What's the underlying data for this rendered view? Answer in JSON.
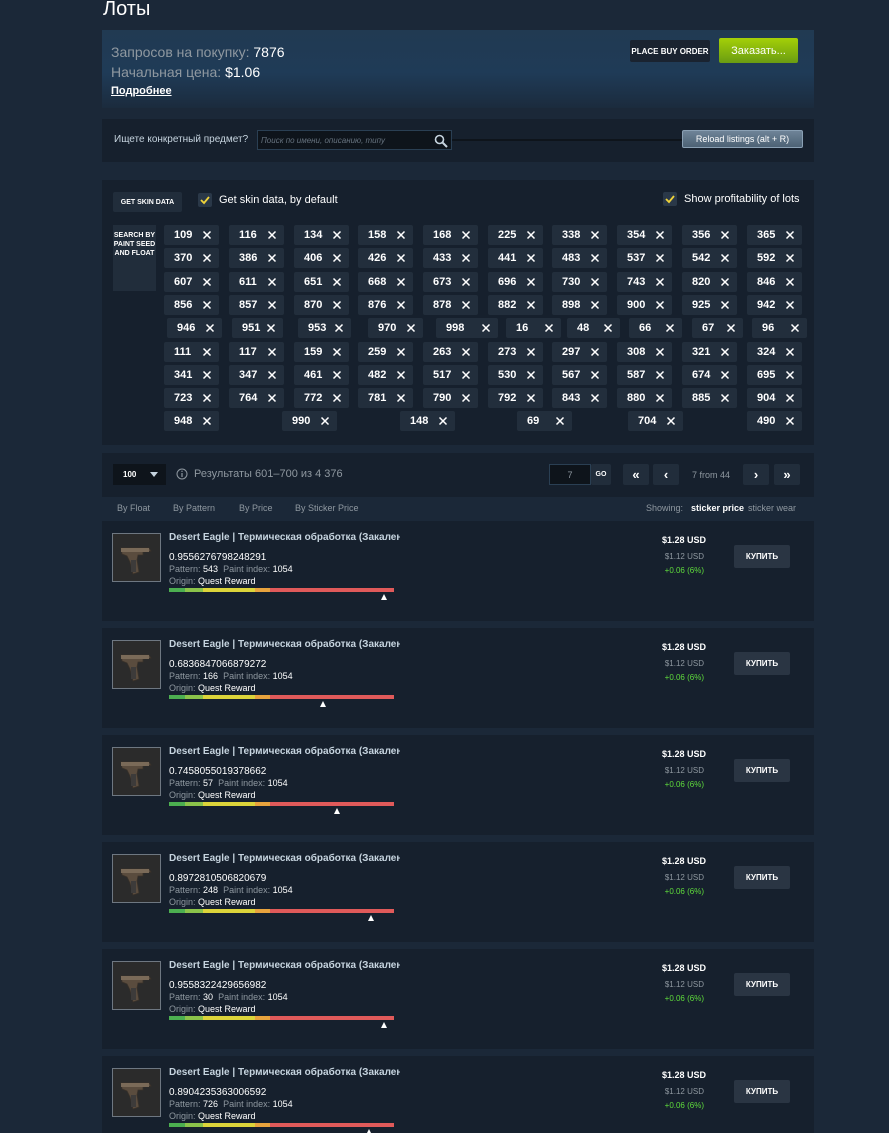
{
  "page": {
    "title": "Лоты"
  },
  "summary": {
    "requests_label": "Запросов на покупку:",
    "requests_value": "7876",
    "start_price_label": "Начальная цена:",
    "start_price_value": "$1.06",
    "more_link": "Подробнее",
    "place_buy_order": "PLACE BUY ORDER",
    "order_button": "Заказать..."
  },
  "search": {
    "label": "Ищете конкретный предмет?",
    "placeholder": "Поиск по имени, описанию, типу",
    "reload": "Reload listings (alt + R)"
  },
  "skin_panel": {
    "get_skin_data": "GET SKIN DATA",
    "get_skin_default": "Get skin data, by default",
    "show_profitability": "Show profitability of lots",
    "search_paint_seed": "SEARCH BY PAINT SEED AND FLOAT",
    "rows": [
      [
        "109",
        "116",
        "134",
        "158",
        "168",
        "225",
        "338",
        "354",
        "356",
        "365"
      ],
      [
        "370",
        "386",
        "406",
        "426",
        "433",
        "441",
        "483",
        "537",
        "542",
        "592"
      ],
      [
        "607",
        "611",
        "651",
        "668",
        "673",
        "696",
        "730",
        "743",
        "820",
        "846"
      ],
      [
        "856",
        "857",
        "870",
        "876",
        "878",
        "882",
        "898",
        "900",
        "925",
        "942"
      ],
      [
        "946",
        "951",
        "953",
        "970",
        "998",
        "16",
        "48",
        "66",
        "67",
        "96"
      ],
      [
        "111",
        "117",
        "159",
        "259",
        "263",
        "273",
        "297",
        "308",
        "321",
        "324"
      ],
      [
        "341",
        "347",
        "461",
        "482",
        "517",
        "530",
        "567",
        "587",
        "674",
        "695"
      ],
      [
        "723",
        "764",
        "772",
        "781",
        "790",
        "792",
        "843",
        "880",
        "885",
        "904"
      ],
      [
        "948",
        "990",
        "148",
        "69",
        "704",
        "490"
      ]
    ]
  },
  "pager": {
    "per_page": "100",
    "results": "Результаты 601–700 из 4 376",
    "page_value": "7",
    "go": "GO",
    "first": "«",
    "prev": "‹",
    "page_of": "7 from 44",
    "next": "›",
    "last": "»"
  },
  "sort": {
    "by_float": "By Float",
    "by_pattern": "By Pattern",
    "by_price": "By Price",
    "by_sticker_price": "By Sticker Price",
    "showing": "Showing:",
    "sticker_price": "sticker price",
    "sticker_wear": "sticker wear"
  },
  "labels": {
    "pattern": "Pattern:",
    "paint_index": "Paint index:",
    "origin": "Origin:",
    "buy": "КУПИТЬ"
  },
  "listings": [
    {
      "title": "Desert Eagle | Термическая обработка (Закаленная в боях)",
      "float": "0.9556276798248291",
      "float_value": 0.9556,
      "pattern": "543",
      "paint_index": "1054",
      "origin": "Quest Reward",
      "price": "$1.28 USD",
      "old_price": "$1.12 USD",
      "diff": "+0.06 (6%)"
    },
    {
      "title": "Desert Eagle | Термическая обработка (Закаленная в боях)",
      "float": "0.6836847066879272",
      "float_value": 0.6837,
      "pattern": "166",
      "paint_index": "1054",
      "origin": "Quest Reward",
      "price": "$1.28 USD",
      "old_price": "$1.12 USD",
      "diff": "+0.06 (6%)"
    },
    {
      "title": "Desert Eagle | Термическая обработка (Закаленная в боях)",
      "float": "0.7458055019378662",
      "float_value": 0.7458,
      "pattern": "57",
      "paint_index": "1054",
      "origin": "Quest Reward",
      "price": "$1.28 USD",
      "old_price": "$1.12 USD",
      "diff": "+0.06 (6%)"
    },
    {
      "title": "Desert Eagle | Термическая обработка (Закаленная в боях)",
      "float": "0.8972810506820679",
      "float_value": 0.8973,
      "pattern": "248",
      "paint_index": "1054",
      "origin": "Quest Reward",
      "price": "$1.28 USD",
      "old_price": "$1.12 USD",
      "diff": "+0.06 (6%)"
    },
    {
      "title": "Desert Eagle | Термическая обработка (Закаленная в боях)",
      "float": "0.9558322429656982",
      "float_value": 0.9558,
      "pattern": "30",
      "paint_index": "1054",
      "origin": "Quest Reward",
      "price": "$1.28 USD",
      "old_price": "$1.12 USD",
      "diff": "+0.06 (6%)"
    },
    {
      "title": "Desert Eagle | Термическая обработка (Закаленная в боях)",
      "float": "0.8904235363006592",
      "float_value": 0.8904,
      "pattern": "726",
      "paint_index": "1054",
      "origin": "Quest Reward",
      "price": "$1.28 USD",
      "old_price": "$1.12 USD",
      "diff": "+0.06 (6%)"
    }
  ],
  "colors": {
    "background": "#1b2838",
    "panel": "#16202d",
    "order_green": "#a4d007",
    "diff_green": "#5fdc3c",
    "wear_fn": "#4caf50",
    "wear_mw": "#8bc34a",
    "wear_ft": "#dcd43a",
    "wear_ww": "#e8a33d",
    "wear_bs": "#e05a5a"
  },
  "icons": [
    "search-icon",
    "check-icon",
    "close-icon",
    "info-icon",
    "chevron-down-icon",
    "desert-eagle-icon"
  ]
}
